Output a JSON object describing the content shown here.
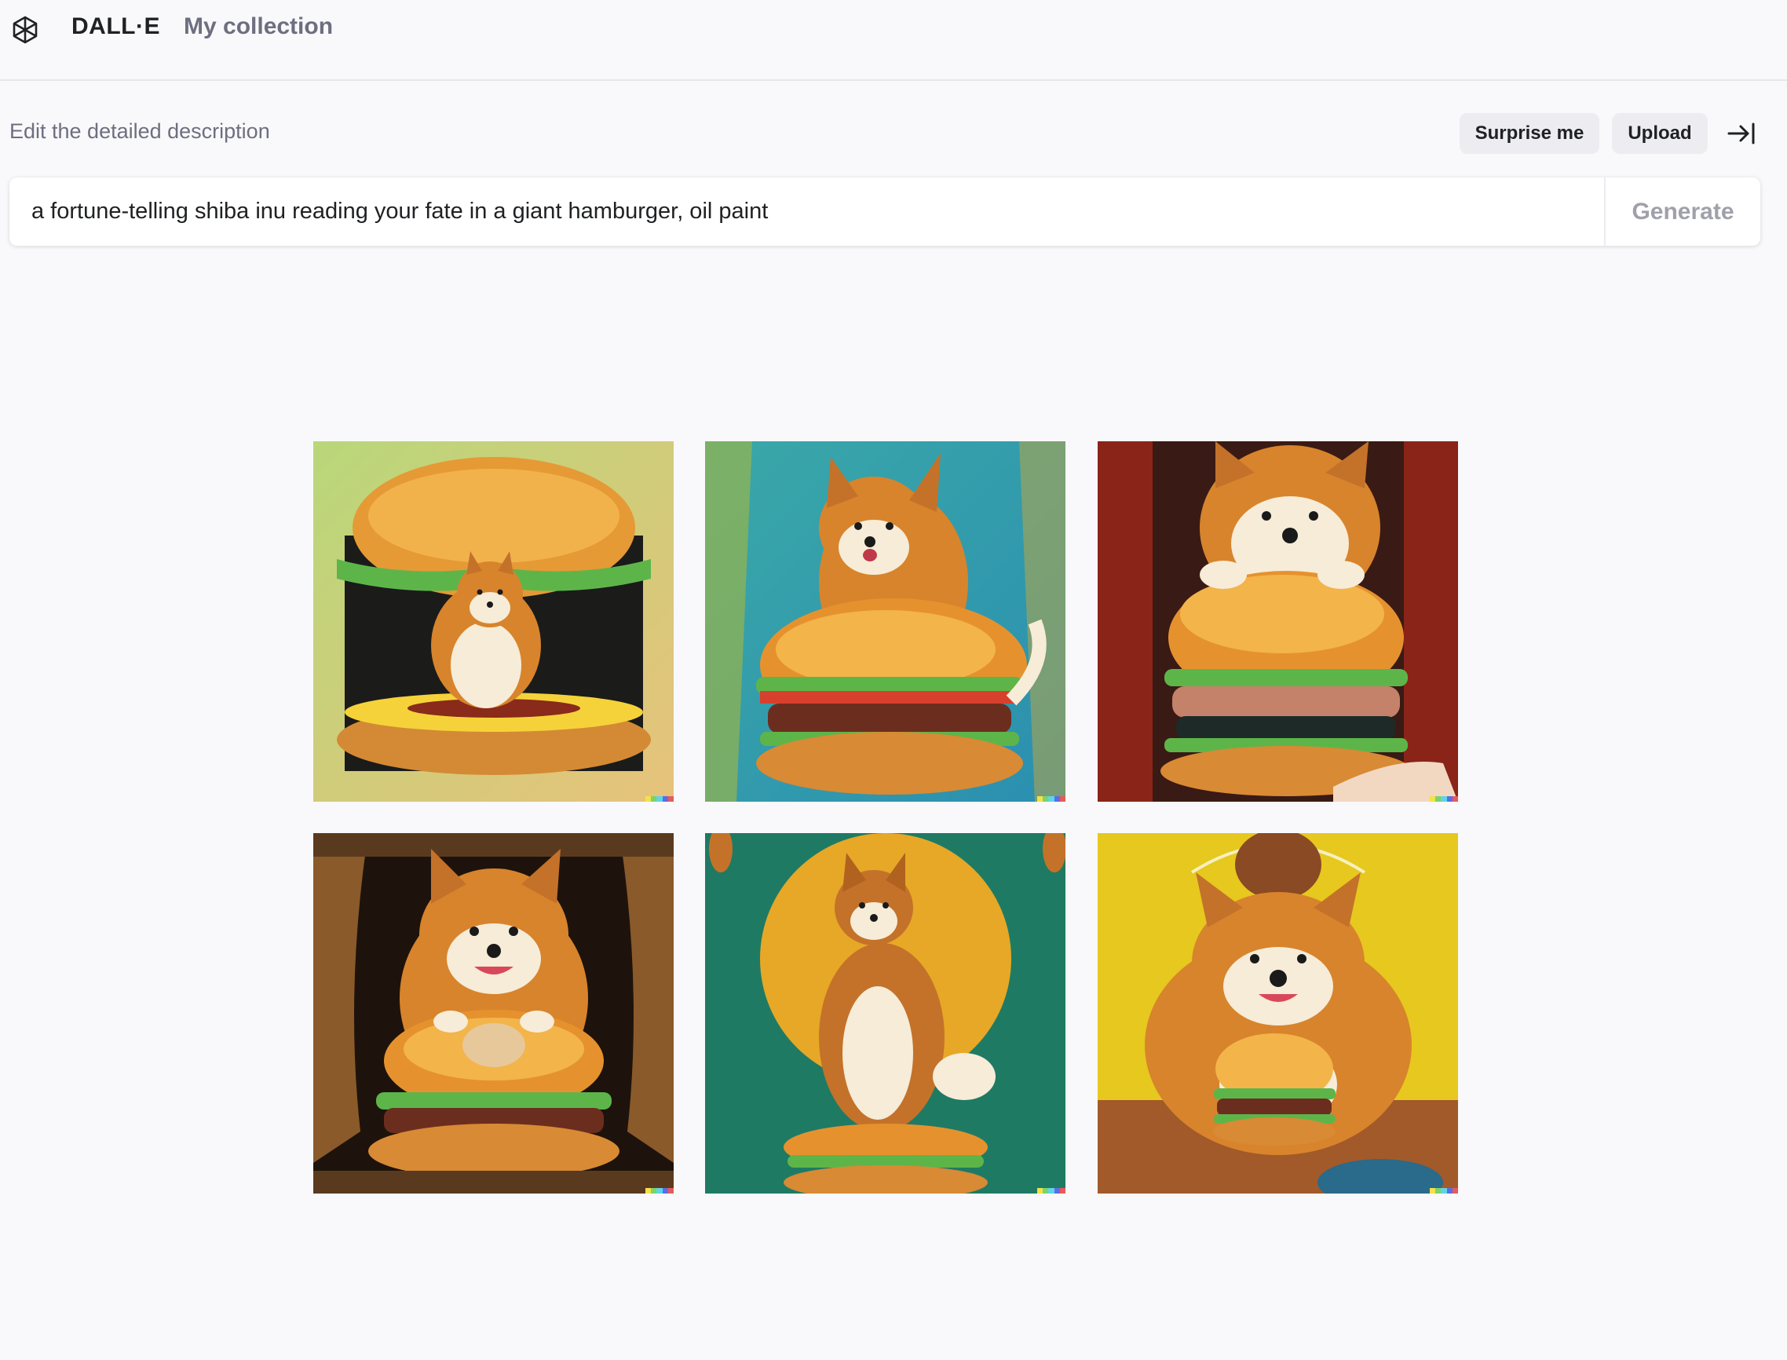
{
  "header": {
    "logo_icon": "openai-logo-icon",
    "brand": "DALL·E",
    "nav_collection": "My collection"
  },
  "prompt_area": {
    "label": "Edit the detailed description",
    "surprise_label": "Surprise me",
    "upload_label": "Upload",
    "collapse_icon": "arrow-right-to-line-icon",
    "prompt_value": "a fortune-telling shiba inu reading your fate in a giant hamburger, oil paint",
    "generate_label": "Generate"
  },
  "results": {
    "images": [
      {
        "name": "shiba-in-burger-bun-sausage",
        "bg": "#c9d98a"
      },
      {
        "name": "shiba-tongue-out-big-burger",
        "bg": "#2f9fa6"
      },
      {
        "name": "shiba-paws-on-burger-red-curtain",
        "bg": "#7a1d14"
      },
      {
        "name": "shiba-smiling-curtains-burger",
        "bg": "#2a1a10"
      },
      {
        "name": "shiba-sitting-on-burger-golden-halo",
        "bg": "#1f7a64"
      },
      {
        "name": "shiba-holding-burger-yellow-wall",
        "bg": "#e6c81e"
      }
    ],
    "signature_colors": [
      "#f4e14a",
      "#7bd36a",
      "#5fd4e6",
      "#5a6de8",
      "#e85a5a"
    ]
  }
}
